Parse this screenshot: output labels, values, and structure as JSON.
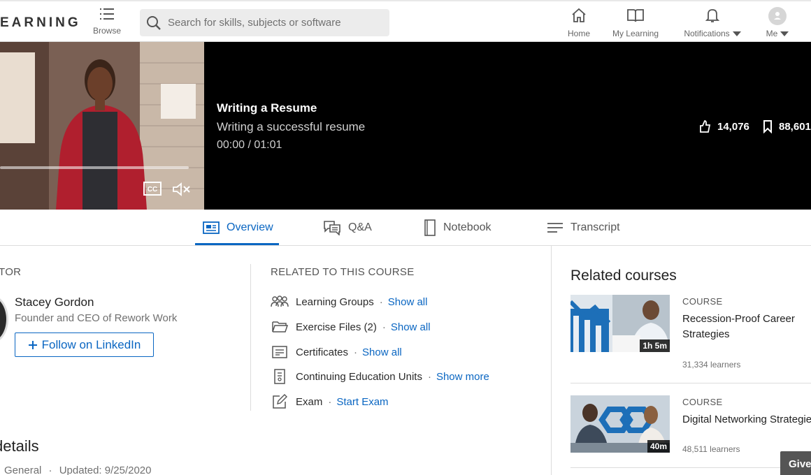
{
  "nav": {
    "logo": "EARNING",
    "browse_label": "Browse",
    "search_placeholder": "Search for skills, subjects or software",
    "items": [
      {
        "label": "Home",
        "icon": "home-icon"
      },
      {
        "label": "My Learning",
        "icon": "book-icon"
      },
      {
        "label": "Notifications",
        "icon": "bell-icon"
      },
      {
        "label": "Me",
        "icon": "avatar"
      }
    ]
  },
  "video": {
    "title": "Writing a Resume",
    "subtitle": "Writing a successful resume",
    "time": "00:00 / 01:01",
    "likes": "14,076",
    "saves": "88,601"
  },
  "tabs": [
    {
      "label": "Overview",
      "icon": "overview-icon",
      "active": true
    },
    {
      "label": "Q&A",
      "icon": "qa-icon",
      "active": false
    },
    {
      "label": "Notebook",
      "icon": "notebook-icon",
      "active": false
    },
    {
      "label": "Transcript",
      "icon": "transcript-icon",
      "active": false
    }
  ],
  "instructor": {
    "heading": "TOR",
    "name": "Stacey Gordon",
    "title": "Founder and CEO of Rework Work",
    "follow_label": "Follow on LinkedIn"
  },
  "related": {
    "heading": "RELATED TO THIS COURSE",
    "rows": [
      {
        "label": "Learning Groups",
        "link": "Show all",
        "icon": "groups-icon"
      },
      {
        "label": "Exercise Files (2)",
        "link": "Show all",
        "icon": "folder-icon"
      },
      {
        "label": "Certificates",
        "link": "Show all",
        "icon": "certificate-icon"
      },
      {
        "label": "Continuing Education Units",
        "link": "Show more",
        "icon": "ceu-icon"
      },
      {
        "label": "Exam",
        "link": "Start Exam",
        "icon": "exam-icon"
      }
    ]
  },
  "details": {
    "heading": "details",
    "level": "General",
    "separator": "·",
    "updated": "Updated: 9/25/2020"
  },
  "related_courses": {
    "heading": "Related courses",
    "cards": [
      {
        "type": "COURSE",
        "title_line1": "Recession-Proof Career",
        "title_line2": "Strategies",
        "duration": "1h 5m",
        "learners": "31,334 learners"
      },
      {
        "type": "COURSE",
        "title_line1": "Digital Networking Strategies",
        "title_line2": "",
        "duration": "40m",
        "learners": "48,511 learners"
      }
    ]
  },
  "give_feedback": "Give",
  "colors": {
    "accent": "#0a66c2",
    "hero_bg": "#000000"
  }
}
